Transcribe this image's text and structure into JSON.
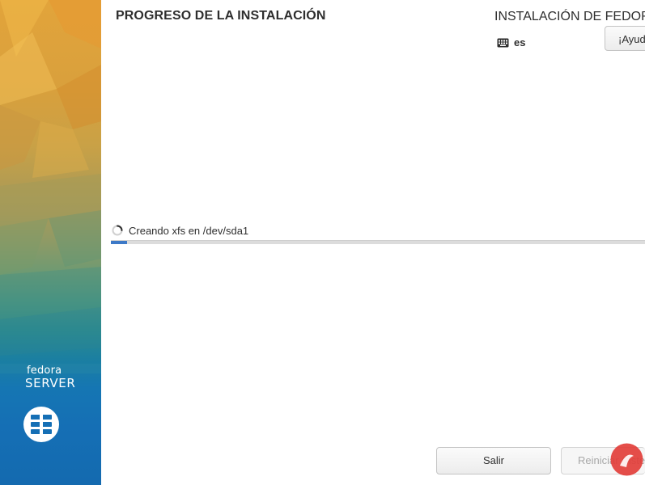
{
  "header": {
    "title": "PROGRESO DE LA INSTALACIÓN",
    "product": "INSTALACIÓN DE FEDORA",
    "keyboard_layout": "es",
    "help_label": "¡Ayuda!"
  },
  "sidebar": {
    "brand_top": "fedora",
    "brand_bottom": "SERVER"
  },
  "progress": {
    "status": "Creando xfs en /dev/sda1",
    "fraction": 0.03
  },
  "footer": {
    "quit_label": "Salir",
    "reboot_label": "Reiniciar Sistema"
  },
  "colors": {
    "progress_fill": "#3d79c7",
    "sidebar_top": "#e2a43b",
    "sidebar_bottom": "#146aaf"
  }
}
